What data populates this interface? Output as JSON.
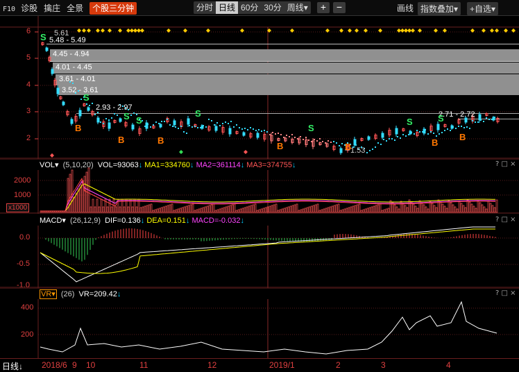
{
  "toolbar": {
    "f10": "F10",
    "items": [
      "诊股",
      "擒庄",
      "全景"
    ],
    "active": "个股三分钟",
    "periods": [
      "分时",
      "日线",
      "60分",
      "30分"
    ],
    "period_active_index": 1,
    "week": "周线▾",
    "zoom_in": "+",
    "zoom_out": "−",
    "draw": "画线",
    "overlay": "指数叠加▾",
    "watchlist": "+自选▾"
  },
  "main_chart": {
    "y_labels": [
      "6",
      "5",
      "4",
      "3",
      "2"
    ],
    "price_bands": [
      {
        "label": "5.48 - 5.49"
      },
      {
        "label": "4.45 - 4.94"
      },
      {
        "label": "4.01 - 4.45"
      },
      {
        "label": "3.61 - 4.01"
      },
      {
        "label": "3.52 - 3.61"
      },
      {
        "label": "2.93 - 2.97"
      },
      {
        "label": "2.71 - 2.72"
      }
    ],
    "high_label": "5.61",
    "low_label": "1.53",
    "buy_marker": "B",
    "sell_marker": "S"
  },
  "vol_panel": {
    "title": "VOL▾",
    "params": "(5,10,20)",
    "vol": "VOL=93063",
    "ma1": "MA1=334760",
    "ma2": "MA2=361114",
    "ma3": "MA3=374755",
    "y_labels": [
      "2000",
      "1000"
    ],
    "unit": "x1000",
    "colors": {
      "ma1": "#ffff00",
      "ma2": "#ff44ff",
      "ma3": "#ff4444",
      "vol": "#ffffff"
    }
  },
  "macd_panel": {
    "title": "MACD▾",
    "params": "(26,12,9)",
    "dif": "DIF=0.136",
    "dea": "DEA=0.151",
    "macd": "MACD=-0.032",
    "y_labels": [
      "0.0",
      "-0.5",
      "-1.0"
    ]
  },
  "vr_panel": {
    "title": "VR▾",
    "params": "(26)",
    "vr": "VR=209.42",
    "y_labels": [
      "400",
      "200"
    ]
  },
  "panel_controls": {
    "help": "?",
    "max": "□",
    "close": "×"
  },
  "x_axis": {
    "period": "日线",
    "labels": [
      "2018/6",
      "9",
      "10",
      "11",
      "12",
      "2019/1",
      "2",
      "3",
      "4"
    ]
  }
}
